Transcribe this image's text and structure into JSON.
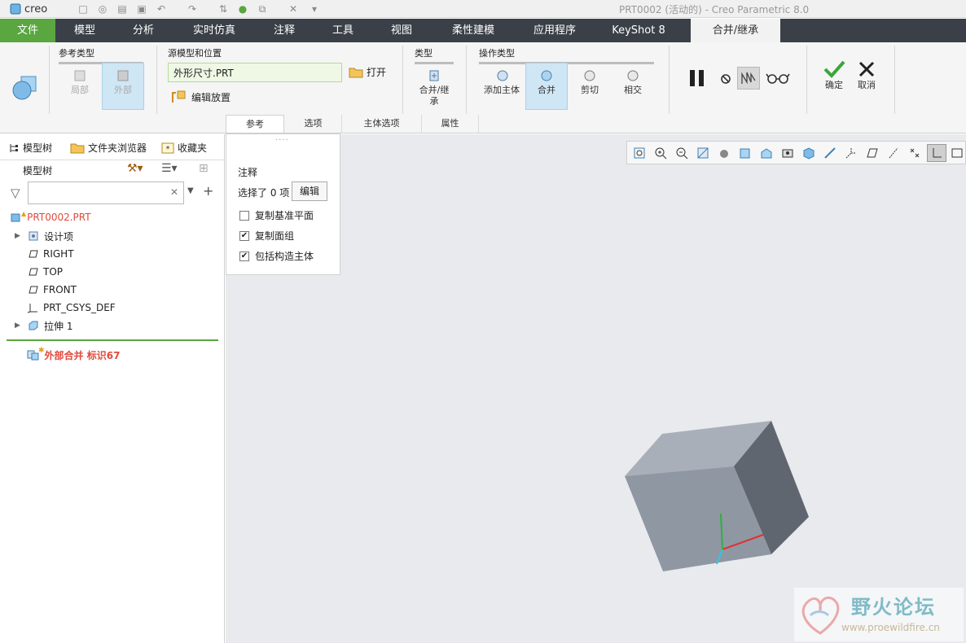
{
  "app": {
    "logo_text": "creo",
    "window_title": "PRT0002 (活动的) - Creo Parametric 8.0"
  },
  "menu": {
    "items": [
      "文件",
      "模型",
      "分析",
      "实时仿真",
      "注释",
      "工具",
      "视图",
      "柔性建模",
      "应用程序",
      "KeyShot 8",
      "合并/继承"
    ]
  },
  "ribbon": {
    "ref_type": {
      "title": "参考类型",
      "local": "局部",
      "external": "外部"
    },
    "source": {
      "title": "源模型和位置",
      "file_value": "外形尺寸.PRT",
      "open": "打开",
      "edit_placement": "编辑放置"
    },
    "type": {
      "title": "类型",
      "merge_inherit": "合并/继承"
    },
    "op_type": {
      "title": "操作类型",
      "add_body": "添加主体",
      "merge": "合并",
      "cut": "剪切",
      "intersect": "相交"
    },
    "confirm": "确定",
    "cancel": "取消"
  },
  "subtabs": [
    "参考",
    "选项",
    "主体选项",
    "属性"
  ],
  "left_panel": {
    "tabs": [
      "模型树",
      "文件夹浏览器",
      "收藏夹"
    ],
    "header": "模型树",
    "search_value": "",
    "tree": [
      {
        "label": "PRT0002.PRT",
        "color": "#e04a3c"
      },
      {
        "label": "设计项",
        "color": "#222"
      },
      {
        "label": "RIGHT",
        "color": "#222"
      },
      {
        "label": "TOP",
        "color": "#222"
      },
      {
        "label": "FRONT",
        "color": "#222"
      },
      {
        "label": "PRT_CSYS_DEF",
        "color": "#222"
      },
      {
        "label": "拉伸 1",
        "color": "#222"
      },
      {
        "label": "外部合并 标识67",
        "color": "#e04a3c"
      }
    ]
  },
  "options_panel": {
    "title": "注释",
    "selected_text": "选择了 0 项",
    "edit_button": "编辑",
    "checkboxes": [
      {
        "label": "复制基准平面",
        "checked": false
      },
      {
        "label": "复制面组",
        "checked": true
      },
      {
        "label": "包括构造主体",
        "checked": true
      }
    ]
  },
  "watermark": {
    "title": "野火论坛",
    "url": "www.proewildfire.cn"
  },
  "colors": {
    "accent_green": "#5aa640",
    "menubar": "#3b4048",
    "highlight": "#cfe6f5",
    "warning_red": "#e04a3c"
  }
}
